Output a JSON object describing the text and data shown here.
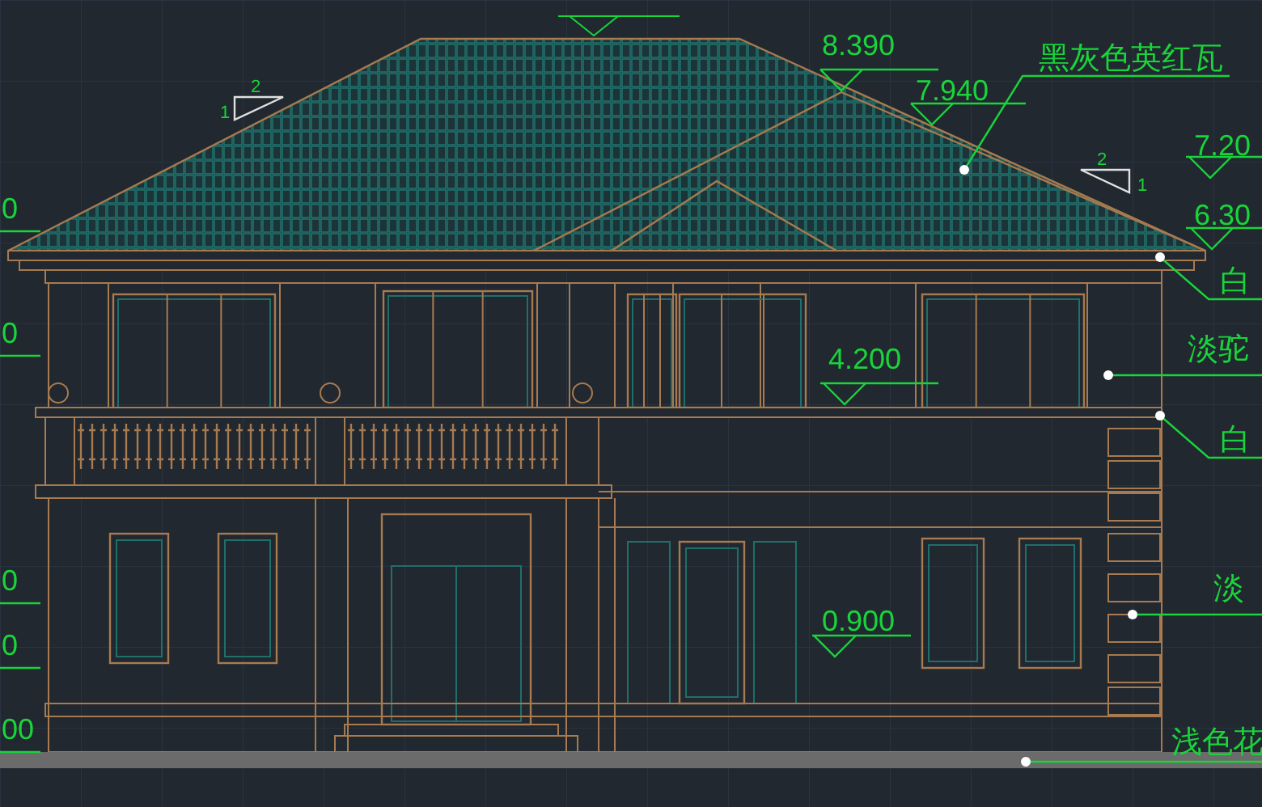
{
  "drawing": {
    "elevation_marks": [
      {
        "label": "8.390"
      },
      {
        "label": "7.940"
      },
      {
        "label": "7.20"
      },
      {
        "label": "6.30"
      },
      {
        "label": "4.200"
      },
      {
        "label": "0.900"
      }
    ],
    "material_notes": [
      {
        "label": "黑灰色英红瓦"
      },
      {
        "label": "白"
      },
      {
        "label": "淡驼"
      },
      {
        "label": "白"
      },
      {
        "label": "淡"
      },
      {
        "label": "浅色花"
      }
    ],
    "slope_marks": [
      {
        "rise": "1",
        "run": "2"
      },
      {
        "rise": "1",
        "run": "2"
      }
    ],
    "edge_marks": [
      {
        "label": "0"
      },
      {
        "label": "0"
      },
      {
        "label": "0"
      },
      {
        "label": "0"
      },
      {
        "label": "00"
      }
    ]
  }
}
